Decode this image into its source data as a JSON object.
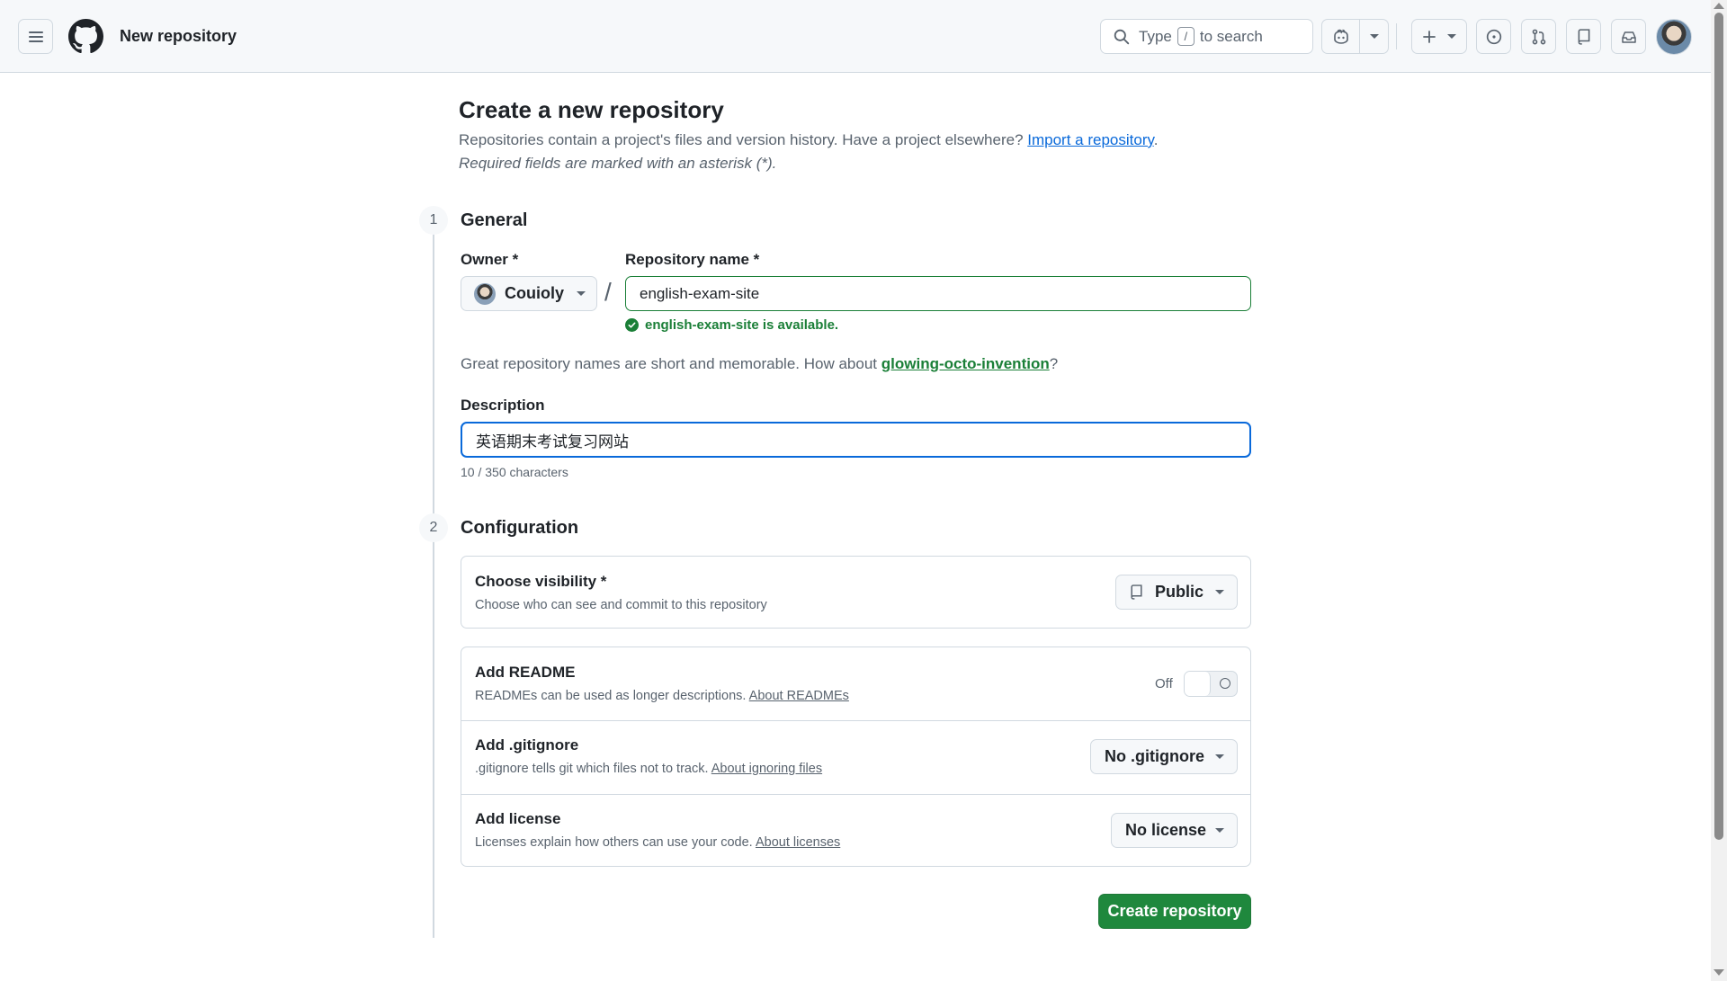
{
  "header": {
    "page_context": "New repository",
    "search": {
      "prefix": "Type",
      "key": "/",
      "suffix": "to search"
    }
  },
  "page": {
    "title": "Create a new repository",
    "lead_text": "Repositories contain a project's files and version history. Have a project elsewhere?",
    "import_link": "Import a repository",
    "lead_end": ".",
    "required_note": "Required fields are marked with an asterisk (*)."
  },
  "general": {
    "step": "1",
    "title": "General",
    "owner_label": "Owner *",
    "owner_value": "Couioly",
    "repo_label": "Repository name *",
    "repo_value": "english-exam-site",
    "availability": "english-exam-site is available.",
    "suggest_text": "Great repository names are short and memorable. How about",
    "suggest_name": "glowing-octo-invention",
    "suggest_end": "?",
    "description_label": "Description",
    "description_value": "英语期末考试复习网站",
    "char_count": "10 / 350 characters"
  },
  "configuration": {
    "step": "2",
    "title": "Configuration",
    "visibility": {
      "title": "Choose visibility *",
      "subtitle": "Choose who can see and commit to this repository",
      "value": "Public"
    },
    "readme": {
      "title": "Add README",
      "subtitle": "READMEs can be used as longer descriptions.",
      "link": "About READMEs",
      "state_label": "Off"
    },
    "gitignore": {
      "title": "Add .gitignore",
      "subtitle": ".gitignore tells git which files not to track.",
      "link": "About ignoring files",
      "value": "No .gitignore"
    },
    "license": {
      "title": "Add license",
      "subtitle": "Licenses explain how others can use your code.",
      "link": "About licenses",
      "value": "No license"
    }
  },
  "actions": {
    "create_label": "Create repository"
  },
  "colors": {
    "accent_green": "#1f883d",
    "link_blue": "#0969da",
    "focus_blue": "#0969da"
  }
}
